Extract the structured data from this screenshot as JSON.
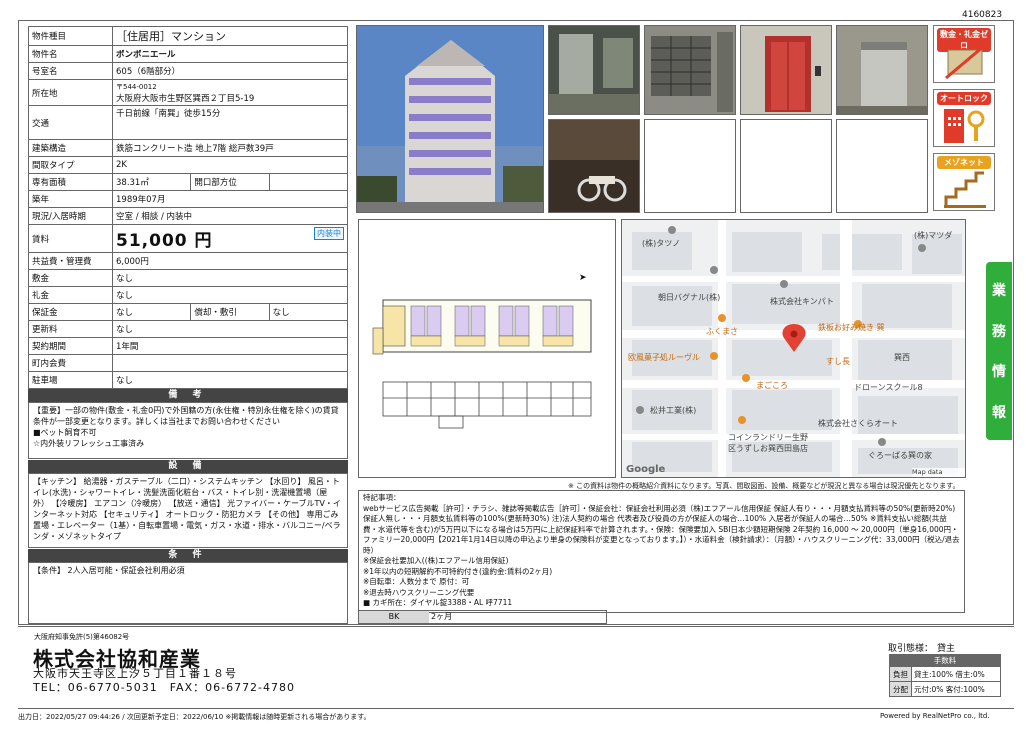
{
  "property_number": "4160823",
  "details": {
    "type_label": "物件種目",
    "type_value": "［住居用］マンション",
    "name_label": "物件名",
    "name_value": "ボンボニエール",
    "room_label": "号室名",
    "room_value": "605（6階部分）",
    "address_label": "所在地",
    "address_postal": "〒544-0012",
    "address_value": "大阪府大阪市生野区巽西２丁目5-19",
    "transport_label": "交通",
    "transport_value": "千日前線「南巽」徒歩15分",
    "structure_label": "建築構造",
    "structure_value": "鉄筋コンクリート造 地上7階 総戸数39戸",
    "layout_label": "間取タイプ",
    "layout_value": "2K",
    "area_label": "専有面積",
    "area_value": "38.31㎡",
    "opening_label": "開口部方位",
    "opening_value": "",
    "built_label": "築年",
    "built_value": "1989年07月",
    "status_label": "現況/入居時期",
    "status_value": "空室 / 相談 / 内装中",
    "rent_label": "賃料",
    "rent_value": "51,000 円",
    "rent_tag": "内装中",
    "fee_label": "共益費・管理費",
    "fee_value": "6,000円",
    "deposit_label": "敷金",
    "deposit_value": "なし",
    "keymoney_label": "礼金",
    "keymoney_value": "なし",
    "guarantee_label": "保証金",
    "guarantee_value": "なし",
    "amort_label": "償却・敷引",
    "amort_value": "なし",
    "renewal_label": "更新料",
    "renewal_value": "なし",
    "contract_label": "契約期間",
    "contract_value": "1年間",
    "town_label": "町内会費",
    "town_value": "",
    "parking_label": "駐車場",
    "parking_value": "なし"
  },
  "notes": {
    "title": "備 考",
    "lines": [
      "【重要】一部の物件(敷金・礼金0円)で外国籍の方(永住権・特別永住権を除く)の賃貸条件が一部変更となります。詳しくは当社までお問い合わせください",
      "■ペット飼育不可",
      "☆内外装リフレッシュ工事済み"
    ]
  },
  "equipment": {
    "title": "設 備",
    "text": "【キッチン】 給湯器・ガステーブル（二口）・システムキッチン 【水回り】 風呂・トイレ(水洗)・シャワートイレ・洗髪洗面化粧台・バス・トイレ別・洗濯機置場（屋外） 【冷暖房】 エアコン（冷暖房） 【放送・通信】 光ファイバー・ケーブルTV・インターネット対応 【セキュリティ】 オートロック・防犯カメラ 【その他】 専用ごみ置場・エレベーター（1基）・自転車置場・電気・ガス・水道・排水・バルコニー/ベランダ・メゾネットタイプ"
  },
  "conditions": {
    "title": "条 件",
    "text": "【条件】 2人入居可能・保証会社利用必須"
  },
  "icons": {
    "deposit_zero": "敷金・礼金ゼロ",
    "autolock": "オートロック",
    "maisonette": "メゾネット"
  },
  "side_tab": [
    "業",
    "務",
    "情",
    "報"
  ],
  "map": {
    "labels": [
      "(株)タツノ",
      "(株)マツダ",
      "朝日バグナル(株)",
      "株式会社キンパト",
      "ふくまさ",
      "鉄板お好み焼き 巽",
      "欧風菓子処ルーヴル",
      "すし長",
      "巽西",
      "まごころ",
      "ドローンスクール8",
      "松井工業(株)",
      "株式会社さくらオート",
      "コインランドリー生野",
      "区うずしお巽西田島店",
      "ぐろーばる巽の家"
    ],
    "google": "Google",
    "mapdata": "Map data ©2020"
  },
  "disclaimer": "※ この資料は物件の概略紹介資料になります。写真、間取図面、設備、概要などが現況と異なる場合は現況優先となります。",
  "remarks": {
    "title": "特記事項：",
    "text": "webサービス広告掲載［許可］・チラシ、雑誌等掲載広告［許可］・保証会社：保証会社利用必須（株)エフアール信用保証 保証人有り・・・月額支払賃料等の50%(更新時20%) 保証人無し・・・月額支払賃料等の100%(更新時30%) 注)法人契約の場合 代表者及び役員の方が保証人の場合…100% 入居者が保証人の場合…50% ※賃料支払い総額(共益費・水道代等を含む)が5万円以下になる場合は5万円に上記保証料率で計算されます。・保険：保険要加入 SBI日本少額短期保険 2年契約 16,000 ～ 20,000円（単身16,000円・ファミリー20,000円【2021年1月14日以降の申込より単身の保険料が変更となっております。】）・水道料金（検針請求）：（月額）・ハウスクリーニング代：33,000円（税込/退去時）",
    "lines": [
      "※保証会社要加入((株)エフアール信用保証)",
      "※1年以内の短期解約不可特約付き(違約金:賃料の2ヶ月)",
      "※自転車：人数分まで 原付：可",
      "※退去時ハウスクリーニング代要",
      "■ カギ所在：ダイヤル錠3388・AL 呼7711"
    ],
    "bk_label": "BK",
    "bk_value": "2ヶ月"
  },
  "footer": {
    "license": "大阪府知事免許(5)第46082号",
    "company": "株式会社協和産業",
    "address": "大阪市天王寺区上汐５丁目１番１８号",
    "tel": "TEL：06-6770-5031　FAX：06-6772-4780",
    "transaction_label": "取引態様：",
    "transaction_value": "貸主",
    "fee_header": "手数料",
    "fee_rows": [
      [
        "負担",
        "貸主:100% 借主:0%"
      ],
      [
        "分配",
        "元付:0% 客付:100%"
      ]
    ],
    "output_info": "出力日：2022/05/27 09:44:26 / 次回更新予定日：2022/06/10 ※掲載情報は随時更新される場合があります。",
    "powered": "Powered by RealNetPro co., ltd."
  }
}
